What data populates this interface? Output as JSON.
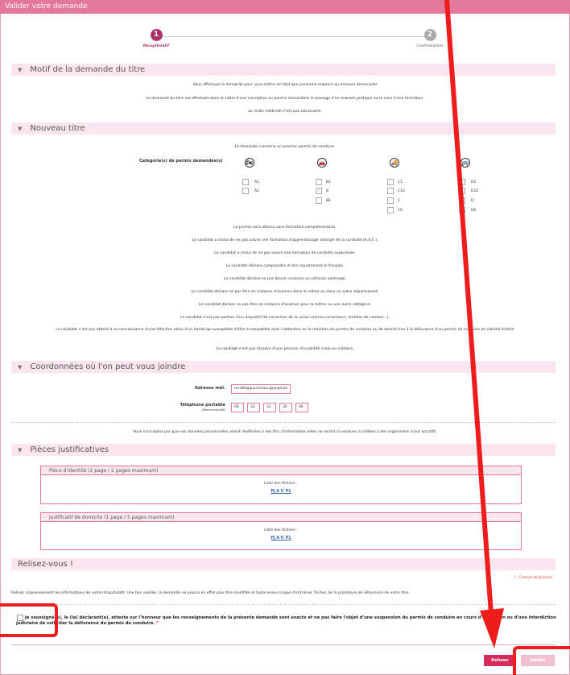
{
  "header": {
    "title": "Valider votre demande"
  },
  "steps": [
    {
      "num": "1",
      "label": "Récapitulatif"
    },
    {
      "num": "2",
      "label": "Confirmation"
    }
  ],
  "sections": {
    "motif": "Motif de la demande du titre",
    "nouveau": "Nouveau titre",
    "coordonnees": "Coordonnées où l'on peut vous joindre",
    "pieces": "Pièces justificatives",
    "relisez": "Relisez-vous !"
  },
  "motif_lines": [
    "Vous effectuez la demande pour vous-même en tant que personne majeure ou mineure émancipée",
    "La demande du titre est effectuée dans le cadre d'une inscription au permis nécessitant le passage d'un examen pratique ou le suivi d'une formation.",
    "La visite médicale n'est pas nécessaire."
  ],
  "nouveau_intro": "La demande concerne un premier permis de conduire.",
  "categories": {
    "label": "Catégorie(s) de permis demandée(s)",
    "groups": [
      {
        "icon": "motorcycle-icon",
        "glyph": "🏍",
        "options": [
          {
            "code": "A1",
            "checked": false
          },
          {
            "code": "A2",
            "checked": false
          }
        ]
      },
      {
        "icon": "car-icon",
        "glyph": "🚗",
        "options": [
          {
            "code": "B1",
            "checked": false
          },
          {
            "code": "B",
            "checked": true
          },
          {
            "code": "BE",
            "checked": false
          }
        ]
      },
      {
        "icon": "truck-icon",
        "glyph": "🚚",
        "options": [
          {
            "code": "C1",
            "checked": false
          },
          {
            "code": "C1E",
            "checked": false
          },
          {
            "code": "C",
            "checked": false
          },
          {
            "code": "CE",
            "checked": false
          }
        ]
      },
      {
        "icon": "bus-icon",
        "glyph": "🚌",
        "options": [
          {
            "code": "D1",
            "checked": false
          },
          {
            "code": "D1E",
            "checked": false
          },
          {
            "code": "D",
            "checked": false
          },
          {
            "code": "DE",
            "checked": false
          }
        ]
      }
    ]
  },
  "statements": [
    "Le permis sera obtenu sans formation complémentaire.",
    "Le candidat a choisi de ne pas suivre une formation d'apprentissage anticipé de la conduite (A.A.C.).",
    "Le candidat a choisi de ne pas suivre une formation de conduite supervisée.",
    "Le candidat déclare comprendre et lire couramment le français.",
    "Le candidat déclare ne pas devoir conduire un véhicule aménagé.",
    "Le candidat déclare ne pas être en instance d'examen dans le même ou dans un autre département.",
    "Le candidat déclare ne pas être en instance d'examen pour la même ou une autre catégorie.",
    "Le candidat n'est pas porteur d'un dispositif de correction de la vision (verres correcteurs, lentilles de contact...).",
    "Le candidat n'est pas atteint à sa connaissance d'une affection et/ou d'un handicap susceptible d'être incompatible avec l'obtention ou le maintien du permis de conduire ou de donner lieu à la délivrance d'un permis de conduire de validité limitée",
    "Le candidat n'est pas titulaire d'une pension d'invalidité civile ou militaire."
  ],
  "contact": {
    "email_label": "Adresse mél.",
    "email_value": "recetteqquarantaun@yopmail",
    "phone_label": "Téléphone portable",
    "phone_sub": "(Recommandé)",
    "phone_parts": [
      "06",
      "33",
      "33",
      "30",
      "06"
    ],
    "privacy": "Vous n'acceptez pas que vos données personnelles soient réutilisées à des fins d'information (elles ne seront ni vendues ni cédées à des organismes à but lucratif)."
  },
  "pieces": [
    {
      "title": "Pièce d'identité (1 page / 2 pages maximum)",
      "list_label": "Liste des fichiers :",
      "file": "PJ A V_P1"
    },
    {
      "title": "Justificatif de domicile (1 page / 5 pages maximum)",
      "list_label": "Liste des fichiers :",
      "file": "PJ A V_P1"
    }
  ],
  "relisez": {
    "required_note": "* : Champs obligatoires",
    "text": "Relisez soigneusement les informations de votre récapitulatif. Une fois validée, la demande ne pourra en effet plus être modifiée et toute erreur risque d'entraîner l'échec de la procédure de délivrance de votre titre.",
    "consent": "Je soussigné(e), le (la) déclarant(e), atteste sur l'honneur que les renseignements de la présente demande sont exacts et ne pas faire l'objet d'une suspension du permis de conduire en cours d'exécution ou d'une interdiction judiciaire de solliciter la délivrance du permis de conduire.",
    "star": "*"
  },
  "buttons": {
    "refuse": "Refuser",
    "validate": "Valider"
  },
  "colors": {
    "brand": "#e4779c",
    "section_bg": "#fbe5ef",
    "refuse": "#d62b5b",
    "annotation": "#ee1c1c"
  }
}
